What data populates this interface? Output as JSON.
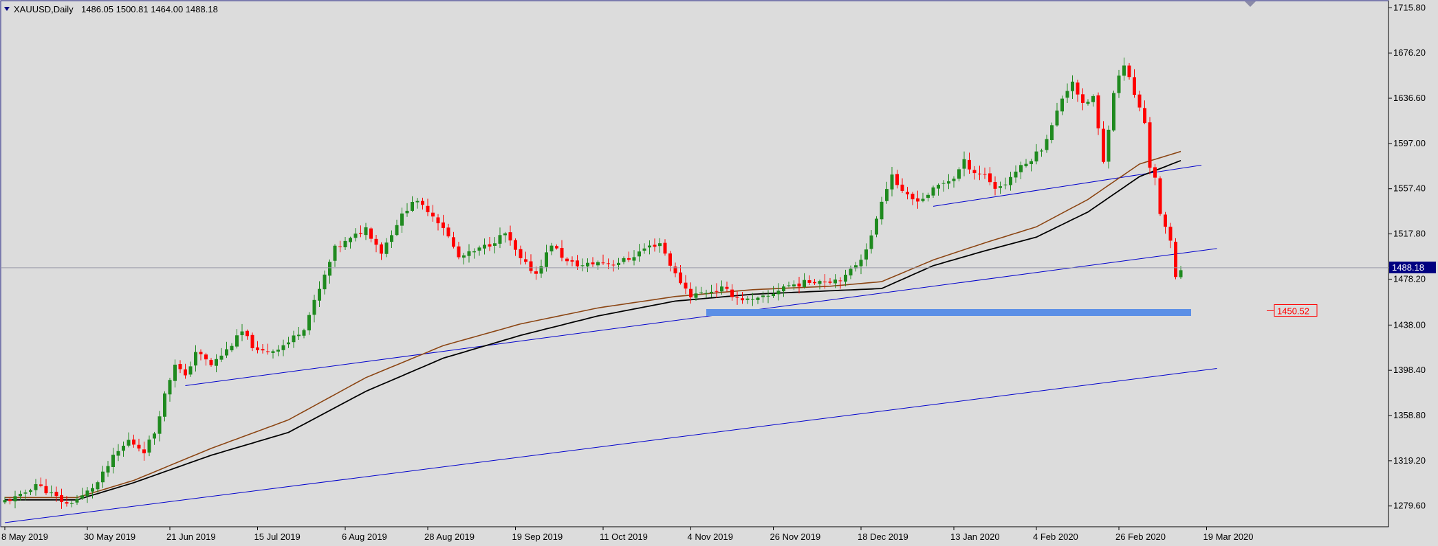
{
  "header": {
    "symbol": "XAUUSD,Daily",
    "ohlc": "1486.05 1500.81 1464.00 1488.18"
  },
  "colors": {
    "background": "#dcdcdc",
    "bull": "#1f8a1f",
    "bear": "#ff0000",
    "ma_slow": "#000000",
    "ma_fast": "#8b4513",
    "trendline": "#0000cc",
    "zone": "#5b8fe6",
    "price_label_bg": "#000080",
    "alert_text": "#ff0000"
  },
  "current_price_label": "1488.18",
  "alert_label": "1450.52",
  "chart_data": {
    "type": "candlestick",
    "ylim": [
      1262,
      1722
    ],
    "y_ticks": [
      1715.8,
      1676.2,
      1636.6,
      1597.0,
      1557.4,
      1517.8,
      1478.2,
      1438.0,
      1398.4,
      1358.8,
      1319.2,
      1279.6
    ],
    "y_tick_labels": [
      "1715.80",
      "1676.20",
      "1636.60",
      "1597.00",
      "1557.40",
      "1517.80",
      "1478.20",
      "1438.00",
      "1398.40",
      "1358.80",
      "1319.20",
      "1279.60"
    ],
    "x_tick_labels": [
      "8 May 2019",
      "30 May 2019",
      "21 Jun 2019",
      "15 Jul 2019",
      "6 Aug 2019",
      "28 Aug 2019",
      "19 Sep 2019",
      "11 Oct 2019",
      "4 Nov 2019",
      "26 Nov 2019",
      "18 Dec 2019",
      "13 Jan 2020",
      "4 Feb 2020",
      "26 Feb 2020",
      "19 Mar 2020"
    ],
    "x_tick_bar_index": [
      0,
      16,
      32,
      49,
      66,
      82,
      99,
      116,
      133,
      149,
      166,
      184,
      200,
      216,
      233
    ],
    "close_anchors": [
      [
        0,
        1284
      ],
      [
        3,
        1288
      ],
      [
        6,
        1299
      ],
      [
        9,
        1290
      ],
      [
        12,
        1281
      ],
      [
        15,
        1288
      ],
      [
        18,
        1300
      ],
      [
        21,
        1322
      ],
      [
        24,
        1337
      ],
      [
        27,
        1328
      ],
      [
        29,
        1344
      ],
      [
        31,
        1377
      ],
      [
        33,
        1405
      ],
      [
        35,
        1392
      ],
      [
        37,
        1415
      ],
      [
        40,
        1403
      ],
      [
        43,
        1416
      ],
      [
        46,
        1432
      ],
      [
        49,
        1414
      ],
      [
        52,
        1416
      ],
      [
        55,
        1423
      ],
      [
        58,
        1436
      ],
      [
        61,
        1469
      ],
      [
        64,
        1505
      ],
      [
        67,
        1513
      ],
      [
        70,
        1523
      ],
      [
        73,
        1502
      ],
      [
        76,
        1527
      ],
      [
        79,
        1547
      ],
      [
        82,
        1539
      ],
      [
        85,
        1524
      ],
      [
        88,
        1497
      ],
      [
        91,
        1502
      ],
      [
        94,
        1509
      ],
      [
        97,
        1518
      ],
      [
        100,
        1495
      ],
      [
        103,
        1483
      ],
      [
        106,
        1509
      ],
      [
        109,
        1493
      ],
      [
        112,
        1490
      ],
      [
        115,
        1493
      ],
      [
        118,
        1492
      ],
      [
        121,
        1496
      ],
      [
        124,
        1505
      ],
      [
        127,
        1510
      ],
      [
        130,
        1482
      ],
      [
        133,
        1464
      ],
      [
        136,
        1467
      ],
      [
        139,
        1470
      ],
      [
        142,
        1462
      ],
      [
        145,
        1459
      ],
      [
        148,
        1463
      ],
      [
        151,
        1472
      ],
      [
        154,
        1474
      ],
      [
        157,
        1477
      ],
      [
        160,
        1477
      ],
      [
        163,
        1480
      ],
      [
        166,
        1497
      ],
      [
        168,
        1515
      ],
      [
        170,
        1548
      ],
      [
        172,
        1570
      ],
      [
        174,
        1553
      ],
      [
        176,
        1548
      ],
      [
        178,
        1549
      ],
      [
        181,
        1560
      ],
      [
        184,
        1567
      ],
      [
        186,
        1581
      ],
      [
        188,
        1572
      ],
      [
        190,
        1570
      ],
      [
        192,
        1558
      ],
      [
        194,
        1562
      ],
      [
        196,
        1573
      ],
      [
        198,
        1579
      ],
      [
        201,
        1593
      ],
      [
        203,
        1612
      ],
      [
        205,
        1637
      ],
      [
        207,
        1652
      ],
      [
        209,
        1630
      ],
      [
        211,
        1638
      ],
      [
        213,
        1580
      ],
      [
        215,
        1643
      ],
      [
        217,
        1667
      ],
      [
        219,
        1640
      ],
      [
        221,
        1615
      ],
      [
        222,
        1577
      ],
      [
        223,
        1568
      ],
      [
        224,
        1534
      ],
      [
        225,
        1522
      ],
      [
        226,
        1511
      ],
      [
        227,
        1481
      ],
      [
        228,
        1488
      ]
    ],
    "ma_slow_anchors": [
      [
        0,
        1285
      ],
      [
        14,
        1285
      ],
      [
        25,
        1300
      ],
      [
        40,
        1324
      ],
      [
        55,
        1344
      ],
      [
        70,
        1380
      ],
      [
        85,
        1409
      ],
      [
        100,
        1429
      ],
      [
        115,
        1446
      ],
      [
        130,
        1459
      ],
      [
        145,
        1465
      ],
      [
        160,
        1468
      ],
      [
        170,
        1470
      ],
      [
        180,
        1490
      ],
      [
        190,
        1503
      ],
      [
        200,
        1515
      ],
      [
        210,
        1537
      ],
      [
        220,
        1568
      ],
      [
        228,
        1582
      ]
    ],
    "ma_fast_anchors": [
      [
        0,
        1287
      ],
      [
        14,
        1287
      ],
      [
        25,
        1302
      ],
      [
        40,
        1330
      ],
      [
        55,
        1355
      ],
      [
        70,
        1392
      ],
      [
        85,
        1420
      ],
      [
        100,
        1439
      ],
      [
        115,
        1453
      ],
      [
        130,
        1463
      ],
      [
        145,
        1469
      ],
      [
        160,
        1472
      ],
      [
        170,
        1476
      ],
      [
        180,
        1495
      ],
      [
        190,
        1510
      ],
      [
        200,
        1524
      ],
      [
        210,
        1548
      ],
      [
        220,
        1579
      ],
      [
        228,
        1590
      ]
    ],
    "trendlines": [
      {
        "name": "support-long",
        "from": [
          0,
          1265
        ],
        "to": [
          235,
          1400
        ]
      },
      {
        "name": "support-mid",
        "from": [
          35,
          1385
        ],
        "to": [
          235,
          1505
        ]
      },
      {
        "name": "support-upper",
        "from": [
          180,
          1542
        ],
        "to": [
          232,
          1578
        ]
      }
    ],
    "horizontal_zone": {
      "y_low": 1446,
      "y_high": 1452,
      "x_from": 136,
      "x_to": 230
    },
    "current_price": 1488.18,
    "alert_price": 1450.52,
    "grid": false
  }
}
